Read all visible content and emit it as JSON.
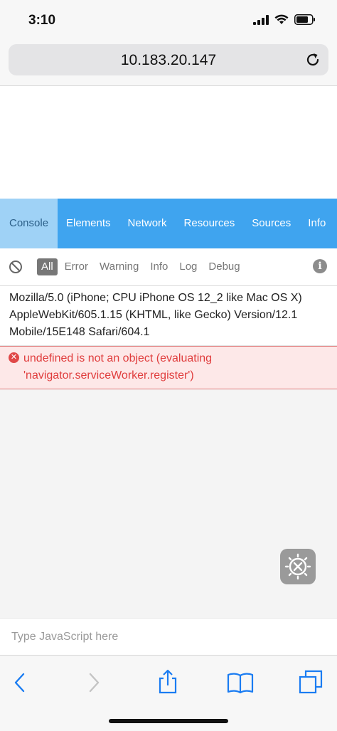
{
  "status": {
    "time": "3:10"
  },
  "browser": {
    "url": "10.183.20.147"
  },
  "devtools": {
    "tabs": [
      {
        "label": "Console",
        "active": true
      },
      {
        "label": "Elements"
      },
      {
        "label": "Network"
      },
      {
        "label": "Resources"
      },
      {
        "label": "Sources"
      },
      {
        "label": "Info"
      }
    ],
    "filters": [
      {
        "label": "All",
        "active": true
      },
      {
        "label": "Error"
      },
      {
        "label": "Warning"
      },
      {
        "label": "Info"
      },
      {
        "label": "Log"
      },
      {
        "label": "Debug"
      }
    ]
  },
  "console": {
    "log_message": "Mozilla/5.0 (iPhone; CPU iPhone OS 12_2 like Mac OS X) AppleWebKit/605.1.15 (KHTML, like Gecko) Version/12.1 Mobile/15E148 Safari/604.1",
    "error_message": "undefined is not an object (evaluating 'navigator.serviceWorker.register')",
    "input_placeholder": "Type JavaScript here"
  },
  "colors": {
    "tab_bar": "#3fa4ef",
    "active_tab": "#9fd2f6",
    "error_text": "#e03d3d",
    "ios_blue": "#1a7cf2"
  }
}
